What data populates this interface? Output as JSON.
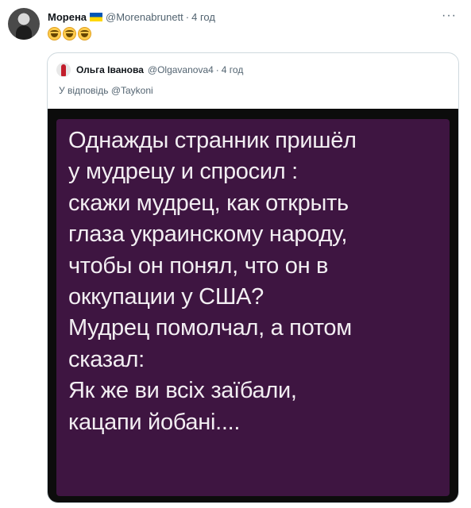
{
  "tweet": {
    "author_name": "Морена",
    "author_handle": "@Morenabrunett",
    "separator": "·",
    "time": "4 год",
    "flag_colors": [
      "#0057b7",
      "#ffd700"
    ],
    "emojis": [
      "rolling-on-floor-laughing",
      "rolling-on-floor-laughing",
      "rolling-on-floor-laughing"
    ],
    "menu_label": "···"
  },
  "quoted": {
    "author_name": "Ольга Іванова",
    "author_handle": "@Olgavanova4",
    "separator": "·",
    "time": "4 год",
    "reply_prefix": "У відповідь",
    "reply_mention": "@Taykoni",
    "image_text": "Однажды странник пришёл\nу мудрецу и спросил :\nскажи мудрец, как открыть\nглаза украинскому народу,\nчтобы он понял, что он в\nоккупации у США?\nМудрец помолчал, а потом\nсказал:\nЯк же ви всіх заїбали,\nкацапи йобані...."
  }
}
